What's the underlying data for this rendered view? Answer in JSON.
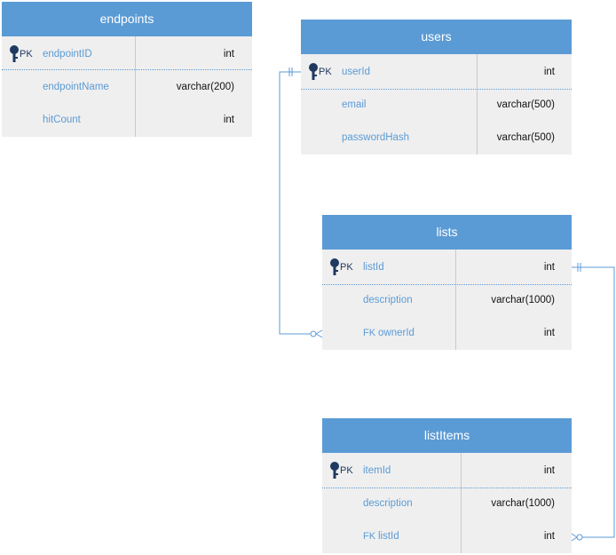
{
  "tables": {
    "endpoints": {
      "title": "endpoints",
      "rows": [
        {
          "key": "PK",
          "name": "endpointID",
          "type": "int"
        },
        {
          "key": "",
          "name": "endpointName",
          "type": "varchar(200)"
        },
        {
          "key": "",
          "name": "hitCount",
          "type": "int"
        }
      ]
    },
    "users": {
      "title": "users",
      "rows": [
        {
          "key": "PK",
          "name": "userId",
          "type": "int"
        },
        {
          "key": "",
          "name": "email",
          "type": "varchar(500)"
        },
        {
          "key": "",
          "name": "passwordHash",
          "type": "varchar(500)"
        }
      ]
    },
    "lists": {
      "title": "lists",
      "rows": [
        {
          "key": "PK",
          "name": "listId",
          "type": "int"
        },
        {
          "key": "",
          "name": "description",
          "type": "varchar(1000)"
        },
        {
          "key": "FK",
          "name": "ownerId",
          "type": "int"
        }
      ]
    },
    "listItems": {
      "title": "listItems",
      "rows": [
        {
          "key": "PK",
          "name": "itemId",
          "type": "int"
        },
        {
          "key": "",
          "name": "description",
          "type": "varchar(1000)"
        },
        {
          "key": "FK",
          "name": "listId",
          "type": "int"
        }
      ]
    }
  },
  "colors": {
    "header": "#5b9bd5",
    "body": "#efefef",
    "connector": "#5b9bd5",
    "key_icon": "#1f3a60"
  },
  "relationships": [
    {
      "from": "users.userId",
      "to": "lists.ownerId",
      "type": "one-to-many"
    },
    {
      "from": "lists.listId",
      "to": "listItems.listId",
      "type": "one-to-many"
    }
  ]
}
